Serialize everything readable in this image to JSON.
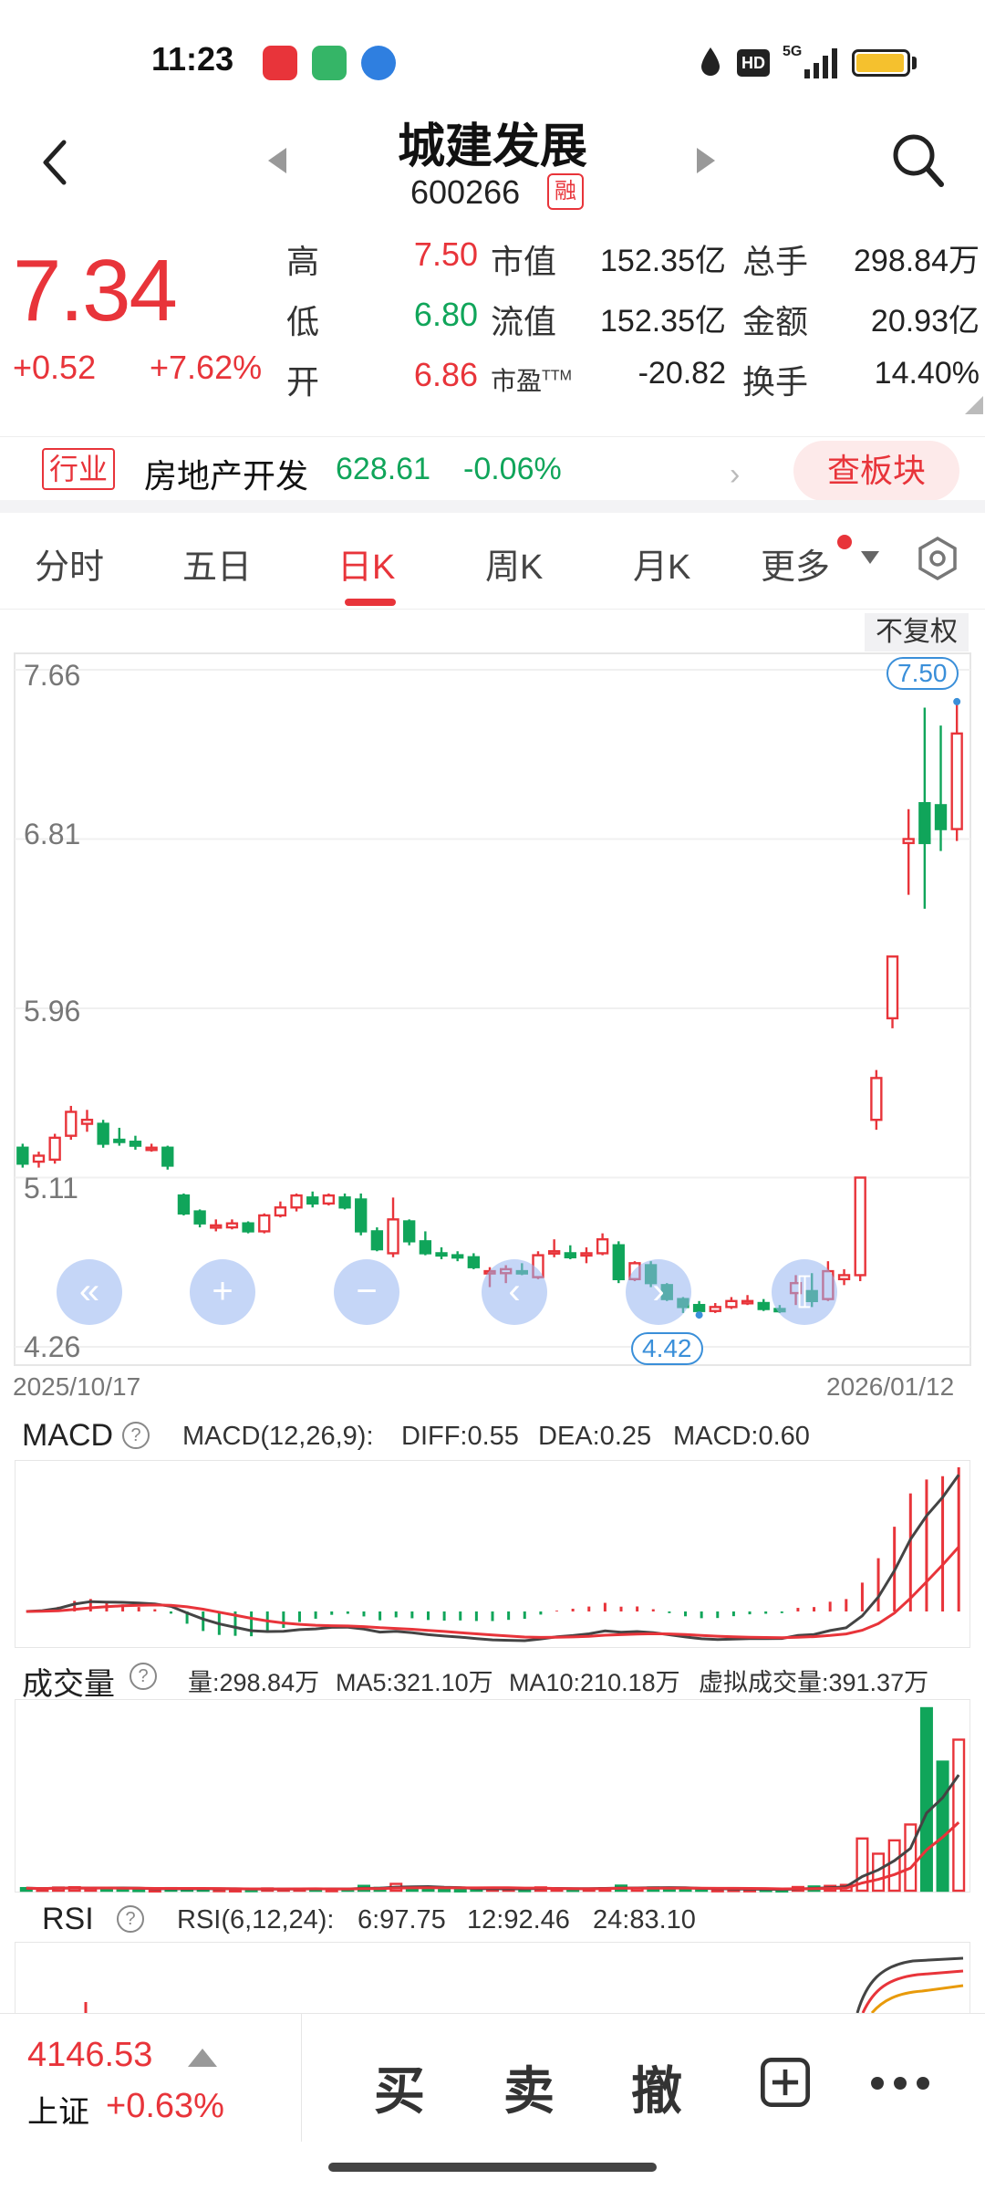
{
  "status_bar": {
    "time": "11:23",
    "network": "5G"
  },
  "header": {
    "stock_name": "城建发展",
    "stock_code": "600266",
    "margin_badge": "融"
  },
  "quote": {
    "price": "7.34",
    "change": "+0.52",
    "change_pct": "+7.62%",
    "high_label": "高",
    "high": "7.50",
    "low_label": "低",
    "low": "6.80",
    "open_label": "开",
    "open": "6.86",
    "mcap_label": "市值",
    "mcap": "152.35亿",
    "float_label": "流值",
    "float_mcap": "152.35亿",
    "pe_label": "市盈",
    "pe_sup": "TTM",
    "pe": "-20.82",
    "volume_label": "总手",
    "volume": "298.84万",
    "amount_label": "金额",
    "amount": "20.93亿",
    "turnover_label": "换手",
    "turnover": "14.40%"
  },
  "industry": {
    "tag": "行业",
    "name": "房地产开发",
    "price": "628.61",
    "change": "-0.06%",
    "button": "查板块"
  },
  "tabs": [
    {
      "label": "分时"
    },
    {
      "label": "五日"
    },
    {
      "label": "日K",
      "active": true
    },
    {
      "label": "周K"
    },
    {
      "label": "月K"
    },
    {
      "label": "更多"
    }
  ],
  "chart": {
    "adjust": "不复权",
    "y_ticks": [
      "7.66",
      "6.81",
      "5.96",
      "5.11",
      "4.26"
    ],
    "start_date": "2025/10/17",
    "end_date": "2026/01/12",
    "max_marker": "7.50",
    "min_marker": "4.42",
    "nav": [
      "«",
      "+",
      "−",
      "‹",
      "›",
      "⟦"
    ]
  },
  "chart_data": {
    "type": "candlestick",
    "ylim": [
      4.26,
      7.66
    ],
    "candles": [
      [
        5.26,
        5.18,
        5.28,
        5.16
      ],
      [
        5.19,
        5.22,
        5.24,
        5.16
      ],
      [
        5.2,
        5.31,
        5.33,
        5.18
      ],
      [
        5.32,
        5.44,
        5.47,
        5.3
      ],
      [
        5.38,
        5.4,
        5.45,
        5.34
      ],
      [
        5.38,
        5.28,
        5.4,
        5.26
      ],
      [
        5.3,
        5.29,
        5.36,
        5.27
      ],
      [
        5.29,
        5.27,
        5.32,
        5.25
      ],
      [
        5.26,
        5.26,
        5.28,
        5.24
      ],
      [
        5.26,
        5.17,
        5.27,
        5.15
      ],
      [
        5.02,
        4.93,
        5.03,
        4.92
      ],
      [
        4.94,
        4.88,
        4.95,
        4.86
      ],
      [
        4.86,
        4.87,
        4.9,
        4.84
      ],
      [
        4.86,
        4.88,
        4.9,
        4.85
      ],
      [
        4.88,
        4.84,
        4.89,
        4.83
      ],
      [
        4.84,
        4.92,
        4.93,
        4.83
      ],
      [
        4.92,
        4.96,
        4.99,
        4.91
      ],
      [
        4.96,
        5.02,
        5.03,
        4.94
      ],
      [
        5.01,
        4.98,
        5.04,
        4.96
      ],
      [
        4.98,
        5.02,
        5.03,
        4.97
      ],
      [
        5.01,
        4.96,
        5.03,
        4.95
      ],
      [
        5.0,
        4.84,
        5.03,
        4.82
      ],
      [
        4.84,
        4.75,
        4.86,
        4.74
      ],
      [
        4.73,
        4.9,
        5.01,
        4.71
      ],
      [
        4.89,
        4.79,
        4.9,
        4.77
      ],
      [
        4.79,
        4.73,
        4.84,
        4.72
      ],
      [
        4.73,
        4.72,
        4.76,
        4.7
      ],
      [
        4.72,
        4.71,
        4.74,
        4.69
      ],
      [
        4.71,
        4.66,
        4.73,
        4.65
      ],
      [
        4.63,
        4.64,
        4.66,
        4.56
      ],
      [
        4.63,
        4.65,
        4.67,
        4.58
      ],
      [
        4.64,
        4.63,
        4.68,
        4.62
      ],
      [
        4.61,
        4.72,
        4.74,
        4.6
      ],
      [
        4.73,
        4.74,
        4.8,
        4.71
      ],
      [
        4.73,
        4.71,
        4.77,
        4.7
      ],
      [
        4.72,
        4.73,
        4.76,
        4.68
      ],
      [
        4.73,
        4.8,
        4.83,
        4.72
      ],
      [
        4.77,
        4.6,
        4.79,
        4.58
      ],
      [
        4.6,
        4.68,
        4.69,
        4.59
      ],
      [
        4.67,
        4.58,
        4.69,
        4.56
      ],
      [
        4.57,
        4.5,
        4.58,
        4.49
      ],
      [
        4.5,
        4.46,
        4.51,
        4.43
      ],
      [
        4.47,
        4.44,
        4.49,
        4.42
      ],
      [
        4.44,
        4.46,
        4.48,
        4.43
      ],
      [
        4.46,
        4.49,
        4.51,
        4.45
      ],
      [
        4.49,
        4.49,
        4.52,
        4.47
      ],
      [
        4.48,
        4.45,
        4.5,
        4.44
      ],
      [
        4.45,
        4.44,
        4.47,
        4.43
      ],
      [
        4.53,
        4.58,
        4.62,
        4.47
      ],
      [
        4.54,
        4.49,
        4.63,
        4.46
      ],
      [
        4.5,
        4.64,
        4.69,
        4.49
      ],
      [
        4.6,
        4.62,
        4.65,
        4.57
      ],
      [
        4.62,
        5.11,
        5.11,
        4.59
      ],
      [
        5.4,
        5.61,
        5.65,
        5.35
      ],
      [
        5.91,
        6.22,
        6.22,
        5.86
      ],
      [
        6.79,
        6.81,
        6.96,
        6.53
      ],
      [
        6.99,
        6.79,
        7.47,
        6.46
      ],
      [
        6.98,
        6.86,
        7.38,
        6.75
      ],
      [
        6.86,
        7.34,
        7.5,
        6.8
      ]
    ],
    "macd": {
      "label": "MACD(12,26,9):",
      "diff_label": "DIFF:0.55",
      "dea_label": "DEA:0.25",
      "macd_label": "MACD:0.60"
    },
    "volume": {
      "label": "量:298.84万",
      "ma5": "MA5:321.10万",
      "ma10": "MA10:210.18万",
      "virtual": "虚拟成交量:391.37万"
    },
    "rsi": {
      "label": "RSI(6,12,24):",
      "rsi6": "6:97.75",
      "rsi12": "12:92.46",
      "rsi24": "24:83.10"
    }
  },
  "indicators": {
    "macd_title": "MACD",
    "volume_title": "成交量",
    "rsi_title": "RSI"
  },
  "bottom": {
    "index_value": "4146.53",
    "index_name": "上证",
    "index_change": "+0.63%",
    "buy": "买",
    "sell": "卖",
    "cancel": "撤"
  },
  "colors": {
    "up": "#e8343a",
    "down": "#10a55a",
    "accent": "#e8343a",
    "marker": "#3a8fd9"
  }
}
